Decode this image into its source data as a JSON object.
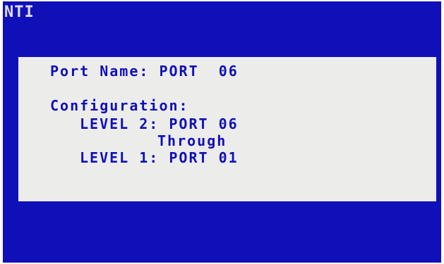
{
  "logo": {
    "text": "NTI"
  },
  "info": {
    "port_name_line": "Port Name: PORT  06",
    "configuration_heading": "Configuration:",
    "level2_line": "LEVEL 2: PORT 06",
    "through_line": "Through",
    "level1_line": "LEVEL 1: PORT 01"
  },
  "colors": {
    "screen_background": "#1010b8",
    "panel_background": "#ececeb",
    "text": "#1010b8",
    "logo": "#dcdcf0"
  }
}
